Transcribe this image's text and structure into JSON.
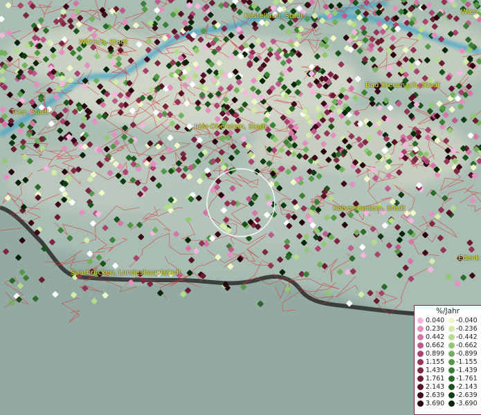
{
  "places": [
    {
      "id": "kastellaun",
      "label": "Kastellaun, Stadt"
    },
    {
      "id": "wiesbaden",
      "label": "Wies"
    },
    {
      "id": "wittlich",
      "label": "Wittlich, Stadt"
    },
    {
      "id": "bad-kreuznach",
      "label": "Bad Kreuznach, Stadt"
    },
    {
      "id": "trier",
      "label": "Trier, Stadt"
    },
    {
      "id": "idar-oberstein",
      "label": "Idar-Oberstein, Stadt"
    },
    {
      "id": "kaiserslautern",
      "label": "Kaiserslautern, Stadt"
    },
    {
      "id": "saarbruecken",
      "label": "Saarbrücken, Landeshauptstadt"
    },
    {
      "id": "edenkoben",
      "label": "Edenk"
    }
  ],
  "legend": {
    "title": "%/Jahr",
    "positive": [
      {
        "value": "0.040",
        "color": "#f2b6df"
      },
      {
        "value": "0.236",
        "color": "#e58fc0"
      },
      {
        "value": "0.442",
        "color": "#d476a8"
      },
      {
        "value": "0.662",
        "color": "#bf5a8c"
      },
      {
        "value": "0.899",
        "color": "#a8446f"
      },
      {
        "value": "1.155",
        "color": "#933456"
      },
      {
        "value": "1.439",
        "color": "#7d2742"
      },
      {
        "value": "1.761",
        "color": "#6a1c33"
      },
      {
        "value": "2.143",
        "color": "#571227"
      },
      {
        "value": "2.639",
        "color": "#3e0a1a"
      },
      {
        "value": "3.690",
        "color": "#25040c"
      }
    ],
    "negative": [
      {
        "value": "-0.040",
        "color": "#eef7c8"
      },
      {
        "value": "-0.236",
        "color": "#d4ecaa"
      },
      {
        "value": "-0.442",
        "color": "#b5dc8c"
      },
      {
        "value": "-0.662",
        "color": "#93c873"
      },
      {
        "value": "-0.899",
        "color": "#72b05d"
      },
      {
        "value": "-1.155",
        "color": "#56984a"
      },
      {
        "value": "-1.439",
        "color": "#3e7f38"
      },
      {
        "value": "-1.761",
        "color": "#2b6a2a"
      },
      {
        "value": "-2.143",
        "color": "#1c531d"
      },
      {
        "value": "-2.639",
        "color": "#0f3c12"
      },
      {
        "value": "-3.690",
        "color": "#062608"
      }
    ]
  }
}
